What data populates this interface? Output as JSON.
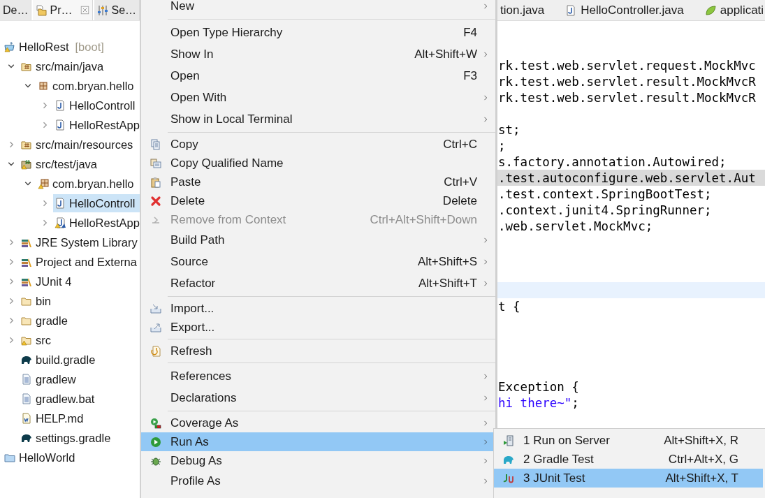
{
  "explorer": {
    "tabs": [
      {
        "label": "De…",
        "kind": "plain",
        "selected": false,
        "closable": false
      },
      {
        "label": "Pr…",
        "kind": "explorer",
        "selected": true,
        "closable": true
      },
      {
        "label": "Se…",
        "kind": "servers",
        "selected": false,
        "closable": false
      }
    ],
    "tree": [
      {
        "label": "HelloRest",
        "decoration": "[boot]",
        "kind": "project",
        "selected": false,
        "children": [
          {
            "label": "src/main/java",
            "kind": "source-folder",
            "expanded": true,
            "selected": false,
            "children": [
              {
                "label": "com.bryan.hello",
                "kind": "package",
                "expanded": true,
                "selected": false,
                "children": [
                  {
                    "label": "HelloControll",
                    "kind": "java-file",
                    "expanded": false,
                    "selected": false
                  },
                  {
                    "label": "HelloRestApp",
                    "kind": "java-file",
                    "expanded": false,
                    "selected": false
                  }
                ]
              }
            ]
          },
          {
            "label": "src/main/resources",
            "kind": "source-folder",
            "expanded": false,
            "selected": false
          },
          {
            "label": "src/test/java",
            "kind": "test-folder",
            "expanded": true,
            "selected": false,
            "children": [
              {
                "label": "com.bryan.hello",
                "kind": "warn-package",
                "expanded": true,
                "selected": false,
                "children": [
                  {
                    "label": "HelloControll",
                    "kind": "java-file",
                    "expanded": false,
                    "selected": true
                  },
                  {
                    "label": "HelloRestApp",
                    "kind": "warn-java-file",
                    "expanded": false,
                    "selected": false
                  }
                ]
              }
            ]
          },
          {
            "label": "JRE System Library",
            "kind": "library",
            "expanded": false,
            "selected": false
          },
          {
            "label": "Project and Externa",
            "kind": "library",
            "expanded": false,
            "selected": false
          },
          {
            "label": "JUnit 4",
            "kind": "library",
            "expanded": false,
            "selected": false
          },
          {
            "label": "bin",
            "kind": "folder",
            "expanded": false,
            "selected": false
          },
          {
            "label": "gradle",
            "kind": "folder",
            "expanded": false,
            "selected": false
          },
          {
            "label": "src",
            "kind": "warn-folder",
            "expanded": false,
            "selected": false
          },
          {
            "label": "build.gradle",
            "kind": "gradle",
            "selected": false
          },
          {
            "label": "gradlew",
            "kind": "text-file",
            "selected": false
          },
          {
            "label": "gradlew.bat",
            "kind": "text-file",
            "selected": false
          },
          {
            "label": "HELP.md",
            "kind": "word-file",
            "selected": false
          },
          {
            "label": "settings.gradle",
            "kind": "gradle",
            "selected": false
          }
        ]
      },
      {
        "label": "HelloWorld",
        "kind": "closed-project",
        "selected": false
      }
    ]
  },
  "context_menu": [
    {
      "kind": "plain",
      "label": "New",
      "submenu": true,
      "selected": false,
      "disabled": false
    },
    {
      "kind": "separator"
    },
    {
      "kind": "plain",
      "label": "Open Type Hierarchy",
      "shortcut": "F4",
      "submenu": false,
      "selected": false,
      "disabled": false
    },
    {
      "kind": "plain",
      "label": "Show In",
      "shortcut": "Alt+Shift+W",
      "submenu": true,
      "selected": false,
      "disabled": false
    },
    {
      "kind": "plain",
      "label": "Open",
      "shortcut": "F3",
      "submenu": false,
      "selected": false,
      "disabled": false
    },
    {
      "kind": "plain",
      "label": "Open With",
      "submenu": true,
      "selected": false,
      "disabled": false
    },
    {
      "kind": "plain",
      "label": "Show in Local Terminal",
      "submenu": true,
      "selected": false,
      "disabled": false
    },
    {
      "kind": "separator"
    },
    {
      "kind": "copy",
      "label": "Copy",
      "shortcut": "Ctrl+C",
      "submenu": false,
      "selected": false,
      "disabled": false
    },
    {
      "kind": "copy-name",
      "label": "Copy Qualified Name",
      "submenu": false,
      "selected": false,
      "disabled": false
    },
    {
      "kind": "paste",
      "label": "Paste",
      "shortcut": "Ctrl+V",
      "submenu": false,
      "selected": false,
      "disabled": false
    },
    {
      "kind": "delete",
      "label": "Delete",
      "shortcut": "Delete",
      "submenu": false,
      "selected": false,
      "disabled": false
    },
    {
      "kind": "remove",
      "label": "Remove from Context",
      "shortcut": "Ctrl+Alt+Shift+Down",
      "submenu": false,
      "selected": false,
      "disabled": true
    },
    {
      "kind": "plain",
      "label": "Build Path",
      "submenu": true,
      "selected": false,
      "disabled": false
    },
    {
      "kind": "plain",
      "label": "Source",
      "shortcut": "Alt+Shift+S",
      "submenu": true,
      "selected": false,
      "disabled": false
    },
    {
      "kind": "plain",
      "label": "Refactor",
      "shortcut": "Alt+Shift+T",
      "submenu": true,
      "selected": false,
      "disabled": false
    },
    {
      "kind": "separator"
    },
    {
      "kind": "import",
      "label": "Import...",
      "submenu": false,
      "selected": false,
      "disabled": false
    },
    {
      "kind": "export",
      "label": "Export...",
      "submenu": false,
      "selected": false,
      "disabled": false
    },
    {
      "kind": "separator"
    },
    {
      "kind": "refresh",
      "label": "Refresh",
      "submenu": false,
      "selected": false,
      "disabled": false
    },
    {
      "kind": "separator"
    },
    {
      "kind": "plain",
      "label": "References",
      "submenu": true,
      "selected": false,
      "disabled": false
    },
    {
      "kind": "plain",
      "label": "Declarations",
      "submenu": true,
      "selected": false,
      "disabled": false
    },
    {
      "kind": "separator"
    },
    {
      "kind": "coverage",
      "label": "Coverage As",
      "submenu": true,
      "selected": false,
      "disabled": false
    },
    {
      "kind": "run",
      "label": "Run As",
      "submenu": true,
      "selected": true,
      "disabled": false
    },
    {
      "kind": "debug",
      "label": "Debug As",
      "submenu": true,
      "selected": false,
      "disabled": false
    },
    {
      "kind": "plain",
      "label": "Profile As",
      "submenu": true,
      "selected": false,
      "disabled": false
    }
  ],
  "run_as_submenu": [
    {
      "label": "1 Run on Server",
      "shortcut": "Alt+Shift+X, R",
      "kind": "server",
      "selected": false
    },
    {
      "label": "2 Gradle Test",
      "shortcut": "Ctrl+Alt+X, G",
      "kind": "gradle",
      "selected": false
    },
    {
      "label": "3 JUnit Test",
      "shortcut": "Alt+Shift+X, T",
      "kind": "junit",
      "selected": true
    }
  ],
  "editor": {
    "tabs": [
      {
        "label": "tion.java",
        "kind": "plain"
      },
      {
        "label": "HelloController.java",
        "kind": "java-file"
      },
      {
        "label": "applicati",
        "kind": "leaf"
      }
    ],
    "lines": [
      {
        "kind": "blank"
      },
      {
        "kind": "blank"
      },
      {
        "kind": "plain",
        "parts": [
          {
            "text": "rk.test.web.servlet.request.MockMvc",
            "kind": "plain"
          }
        ]
      },
      {
        "kind": "plain",
        "parts": [
          {
            "text": "rk.test.web.servlet.result.MockMvcR",
            "kind": "plain"
          }
        ]
      },
      {
        "kind": "plain",
        "parts": [
          {
            "text": "rk.test.web.servlet.result.MockMvcR",
            "kind": "plain"
          }
        ]
      },
      {
        "kind": "blank"
      },
      {
        "kind": "plain",
        "parts": [
          {
            "text": "st;",
            "kind": "plain"
          }
        ]
      },
      {
        "kind": "plain",
        "parts": [
          {
            "text": ";",
            "kind": "plain"
          }
        ]
      },
      {
        "kind": "plain",
        "parts": [
          {
            "text": "s.factory.annotation.Autowired;",
            "kind": "plain"
          }
        ]
      },
      {
        "kind": "highlighted",
        "parts": [
          {
            "text": ".test.autoconfigure.web.servlet.Aut",
            "kind": "plain"
          }
        ]
      },
      {
        "kind": "plain",
        "parts": [
          {
            "text": ".test.context.SpringBootTest;",
            "kind": "plain"
          }
        ]
      },
      {
        "kind": "plain",
        "parts": [
          {
            "text": ".context.junit4.SpringRunner;",
            "kind": "plain"
          }
        ]
      },
      {
        "kind": "plain",
        "parts": [
          {
            "text": ".web.servlet.MockMvc;",
            "kind": "plain"
          }
        ]
      },
      {
        "kind": "blank"
      },
      {
        "kind": "blank"
      },
      {
        "kind": "blank"
      },
      {
        "kind": "current-line"
      },
      {
        "kind": "plain",
        "parts": [
          {
            "text": "t {",
            "kind": "plain"
          }
        ]
      },
      {
        "kind": "blank"
      },
      {
        "kind": "blank"
      },
      {
        "kind": "blank"
      },
      {
        "kind": "blank"
      },
      {
        "kind": "plain",
        "parts": [
          {
            "text": "Exception {",
            "kind": "plain"
          }
        ]
      },
      {
        "kind": "plain",
        "parts": [
          {
            "text": "hi there~\"",
            "kind": "string"
          },
          {
            "text": ";",
            "kind": "plain"
          }
        ]
      }
    ]
  }
}
